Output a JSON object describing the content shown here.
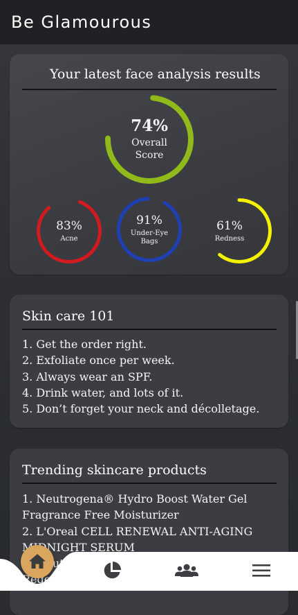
{
  "app": {
    "title": "Be Glamourous"
  },
  "analysis": {
    "heading": "Your latest face analysis results",
    "overall": {
      "percent_text": "74%",
      "label_line1": "Overall",
      "label_line2": "Score",
      "value": 74,
      "color": "#8fba1a"
    },
    "metrics": [
      {
        "percent_text": "83%",
        "label_line1": "Acne",
        "label_line2": "",
        "value": 83,
        "color": "#d21a1f"
      },
      {
        "percent_text": "91%",
        "label_line1": "Under-Eye",
        "label_line2": "Bags",
        "value": 91,
        "color": "#1f3fb4"
      },
      {
        "percent_text": "61%",
        "label_line1": "Redness",
        "label_line2": "",
        "value": 61,
        "color": "#f4f000"
      }
    ]
  },
  "skincare": {
    "heading": "Skin care 101",
    "items": [
      "1. Get the order right.",
      "2. Exfoliate once per week.",
      "3. Always wear an SPF.",
      "4. Drink water, and lots of it.",
      "5. Don’t forget your neck and décolletage."
    ]
  },
  "trending": {
    "heading": "Trending skincare products",
    "lines": [
      "1. Neutrogena® Hydro Boost Water Gel",
      "Fragrance Free Moisturizer",
      "2. L'Oreal CELL RENEWAL ANTI-AGING",
      "MIDNIGHT SERUM",
      "3. Neutrogena® ...",
      "Regen..."
    ]
  },
  "nav": {
    "accent_color": "#d9a55f",
    "items": [
      {
        "icon": "home-icon"
      },
      {
        "icon": "pie-chart-icon"
      },
      {
        "icon": "people-icon"
      },
      {
        "icon": "menu-icon"
      }
    ]
  }
}
